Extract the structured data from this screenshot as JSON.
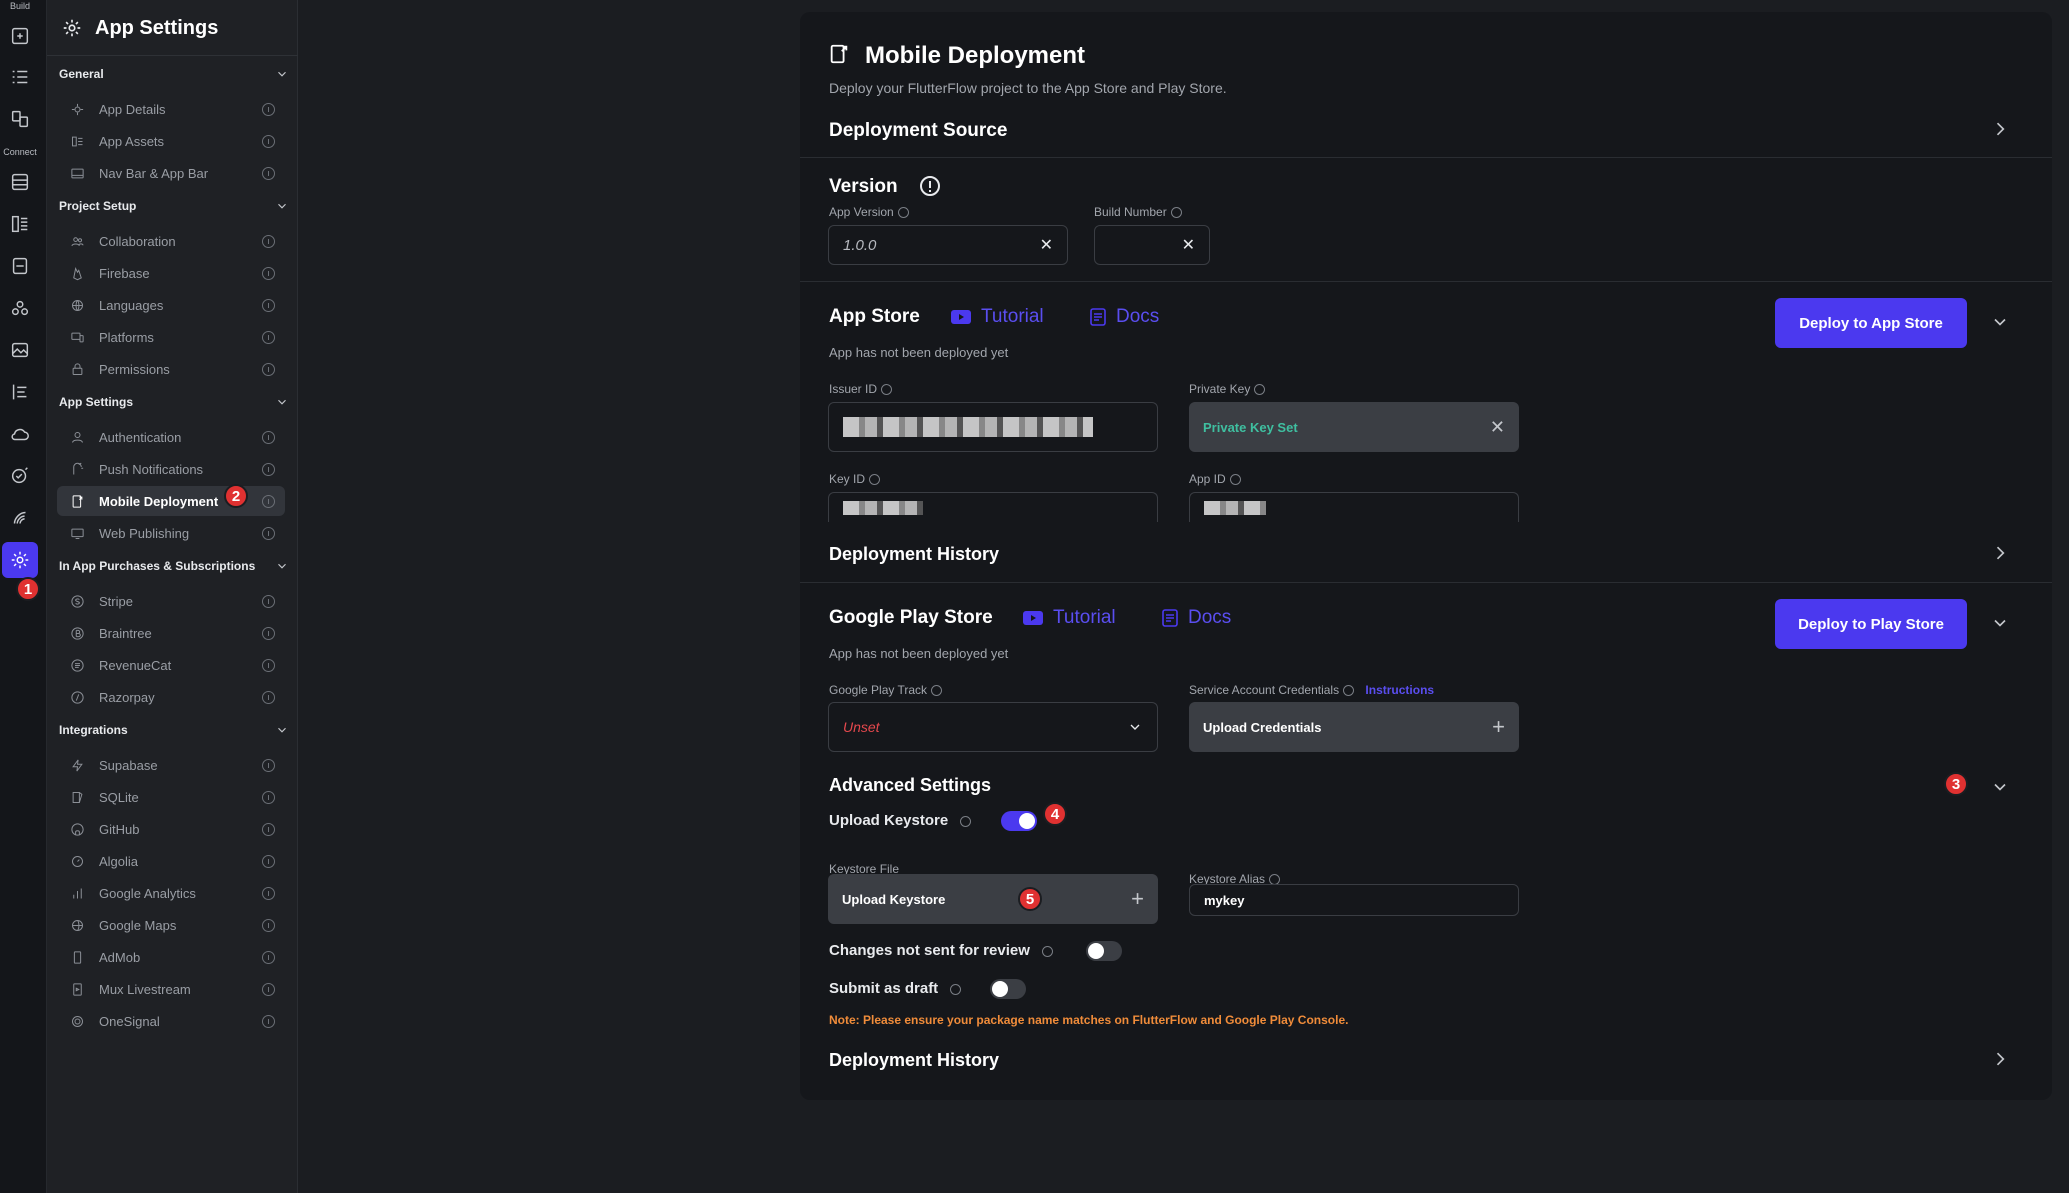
{
  "rail": {
    "build_label": "Build",
    "connect_label": "Connect"
  },
  "sidebar": {
    "title": "App Settings",
    "sections": {
      "general": "General",
      "project_setup": "Project Setup",
      "app_settings": "App Settings",
      "in_app": "In App Purchases & Subscriptions",
      "integrations": "Integrations"
    },
    "items": {
      "app_details": "App Details",
      "app_assets": "App Assets",
      "nav_bar": "Nav Bar & App Bar",
      "collaboration": "Collaboration",
      "firebase": "Firebase",
      "languages": "Languages",
      "platforms": "Platforms",
      "permissions": "Permissions",
      "authentication": "Authentication",
      "push_notifications": "Push Notifications",
      "mobile_deployment": "Mobile Deployment",
      "web_publishing": "Web Publishing",
      "stripe": "Stripe",
      "braintree": "Braintree",
      "revenuecat": "RevenueCat",
      "razorpay": "Razorpay",
      "supabase": "Supabase",
      "sqlite": "SQLite",
      "github": "GitHub",
      "algolia": "Algolia",
      "google_analytics": "Google Analytics",
      "google_maps": "Google Maps",
      "admob": "AdMob",
      "mux": "Mux Livestream",
      "onesignal": "OneSignal"
    }
  },
  "badges": [
    "1",
    "2",
    "3",
    "4",
    "5"
  ],
  "main": {
    "title": "Mobile Deployment",
    "subtitle": "Deploy your FlutterFlow project to the App Store and Play Store.",
    "deployment_source": "Deployment Source",
    "version": {
      "title": "Version",
      "app_version_label": "App Version",
      "app_version_value": "1.0.0",
      "build_number_label": "Build Number",
      "build_number_value": ""
    },
    "app_store": {
      "title": "App Store",
      "tutorial": "Tutorial",
      "docs": "Docs",
      "status": "App has not been deployed yet",
      "deploy_button": "Deploy to App Store",
      "issuer_id_label": "Issuer ID",
      "private_key_label": "Private Key",
      "private_key_value": "Private Key Set",
      "key_id_label": "Key ID",
      "app_id_label": "App ID",
      "history": "Deployment History"
    },
    "play_store": {
      "title": "Google Play Store",
      "tutorial": "Tutorial",
      "docs": "Docs",
      "status": "App has not been deployed yet",
      "deploy_button": "Deploy to Play Store",
      "track_label": "Google Play Track",
      "track_value": "Unset",
      "credentials_label": "Service Account Credentials",
      "instructions": "Instructions",
      "upload_credentials": "Upload Credentials",
      "advanced_settings": "Advanced Settings",
      "upload_keystore_label": "Upload Keystore",
      "upload_keystore_on": true,
      "keystore_file_label": "Keystore File",
      "upload_keystore_button": "Upload Keystore",
      "keystore_alias_label": "Keystore Alias",
      "keystore_alias_value": "mykey",
      "changes_not_sent_label": "Changes not sent for review",
      "changes_not_sent_on": false,
      "submit_draft_label": "Submit as draft",
      "submit_draft_on": false,
      "note": "Note: Please ensure your package name matches on FlutterFlow and Google Play Console.",
      "history": "Deployment History"
    }
  },
  "colors": {
    "accent": "#4b39ef",
    "badge": "#e03131",
    "teal": "#3fbfa0",
    "note": "#f08c3a",
    "unset": "#e5484d"
  }
}
